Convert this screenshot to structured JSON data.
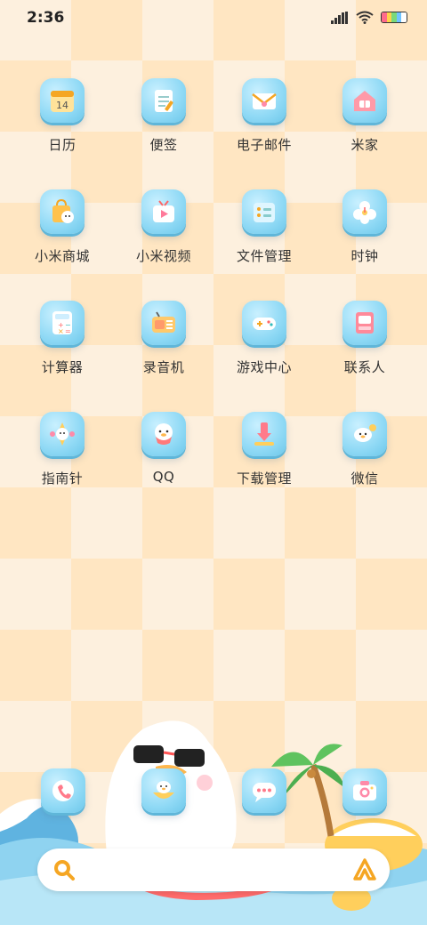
{
  "status_bar": {
    "time": "2:36"
  },
  "apps": [
    {
      "label": "日历",
      "icon": "calendar-icon",
      "badge": "14"
    },
    {
      "label": "便签",
      "icon": "notes-icon"
    },
    {
      "label": "电子邮件",
      "icon": "mail-icon"
    },
    {
      "label": "米家",
      "icon": "home-icon"
    },
    {
      "label": "小米商城",
      "icon": "store-icon"
    },
    {
      "label": "小米视频",
      "icon": "video-icon"
    },
    {
      "label": "文件管理",
      "icon": "file-manager-icon"
    },
    {
      "label": "时钟",
      "icon": "clock-icon"
    },
    {
      "label": "计算器",
      "icon": "calculator-icon"
    },
    {
      "label": "录音机",
      "icon": "recorder-icon"
    },
    {
      "label": "游戏中心",
      "icon": "game-center-icon"
    },
    {
      "label": "联系人",
      "icon": "contacts-icon"
    },
    {
      "label": "指南针",
      "icon": "compass-icon"
    },
    {
      "label": "QQ",
      "icon": "qq-icon"
    },
    {
      "label": "下载管理",
      "icon": "download-icon"
    },
    {
      "label": "微信",
      "icon": "wechat-icon"
    }
  ],
  "dock": [
    {
      "icon": "phone-icon"
    },
    {
      "icon": "browser-icon"
    },
    {
      "icon": "messages-icon"
    },
    {
      "icon": "camera-icon"
    }
  ],
  "colors": {
    "icon_bg": "#8fd9f5",
    "tile_light": "#fdf0de",
    "tile_dark": "#ffe6c2",
    "accent": "#f5a623"
  }
}
